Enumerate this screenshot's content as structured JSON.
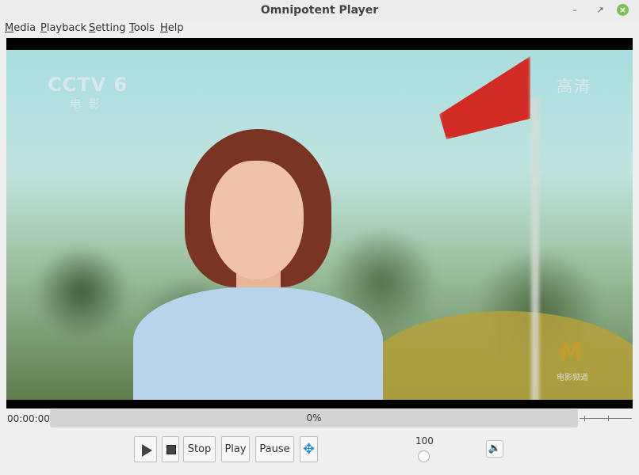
{
  "window": {
    "title": "Omnipotent Player",
    "minimize_glyph": "–",
    "maximize_glyph": "↗",
    "close_glyph": "×"
  },
  "menu": {
    "items": [
      {
        "label": "Media"
      },
      {
        "label": "Playback"
      },
      {
        "label": "Setting"
      },
      {
        "label": "Tools"
      },
      {
        "label": "Help"
      }
    ]
  },
  "video": {
    "logo_text": "CCTV 6",
    "logo_sub": "电影",
    "hd_text": "高清",
    "channel_mark": "M",
    "channel_sub": "电影频道"
  },
  "playback": {
    "elapsed": "00:00:00",
    "progress_label": "0%",
    "progress_value": 0,
    "end_slider": "-:——:——"
  },
  "controls": {
    "stop_label": "Stop",
    "play_label": "Play",
    "pause_label": "Pause",
    "move_icon_glyph": "✥",
    "volume_value": "100",
    "speaker_glyph": "🔉"
  },
  "colors": {
    "accent": "#2a8fd8",
    "close_button": "#7fbf5a",
    "flag": "#d22b24"
  },
  "icons": [
    "play-icon",
    "stop-icon",
    "move-icon",
    "speaker-icon",
    "minimize-icon",
    "maximize-icon",
    "close-icon"
  ]
}
